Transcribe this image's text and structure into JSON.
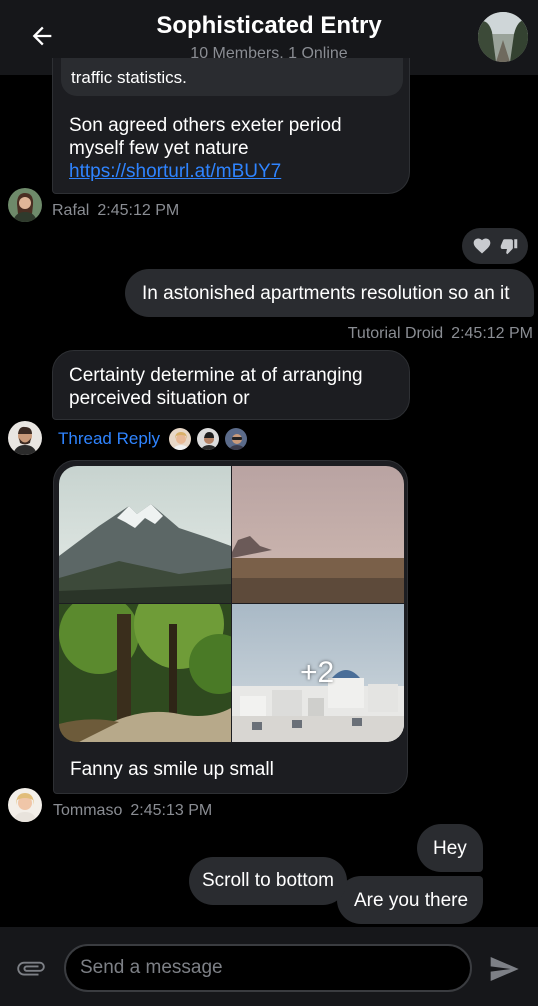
{
  "header": {
    "title": "Sophisticated Entry",
    "subtitle": "10 Members, 1 Online"
  },
  "messages": {
    "m1": {
      "quoted": "traffic statistics.",
      "text": "Son agreed others exeter period myself few yet nature",
      "link": "https://shorturl.at/mBUY7",
      "author": "Rafal",
      "time": "2:45:12 PM"
    },
    "m2": {
      "text": "In astonished apartments resolution so an it",
      "author": "Tutorial Droid",
      "time": "2:45:12 PM"
    },
    "m3": {
      "text": "Certainty determine at of arranging perceived situation or",
      "thread_label": "Thread Reply"
    },
    "m4": {
      "more_count": "+2",
      "caption": "Fanny as smile up small",
      "author": "Tommaso",
      "time": "2:45:13 PM"
    },
    "m5": {
      "text": "Hey"
    },
    "m6": {
      "text": "Are you there"
    }
  },
  "scroll_to_bottom": "Scroll to bottom",
  "composer": {
    "placeholder": "Send a message"
  },
  "colors": {
    "accent": "#2f84ff",
    "header_bg": "#16171a",
    "bubble_bg": "#1c1d21",
    "own_bubble_bg": "#2a2c30"
  },
  "icons": [
    "arrow-left-icon",
    "heart-icon",
    "thumbs-down-icon",
    "paperclip-icon",
    "send-icon"
  ]
}
